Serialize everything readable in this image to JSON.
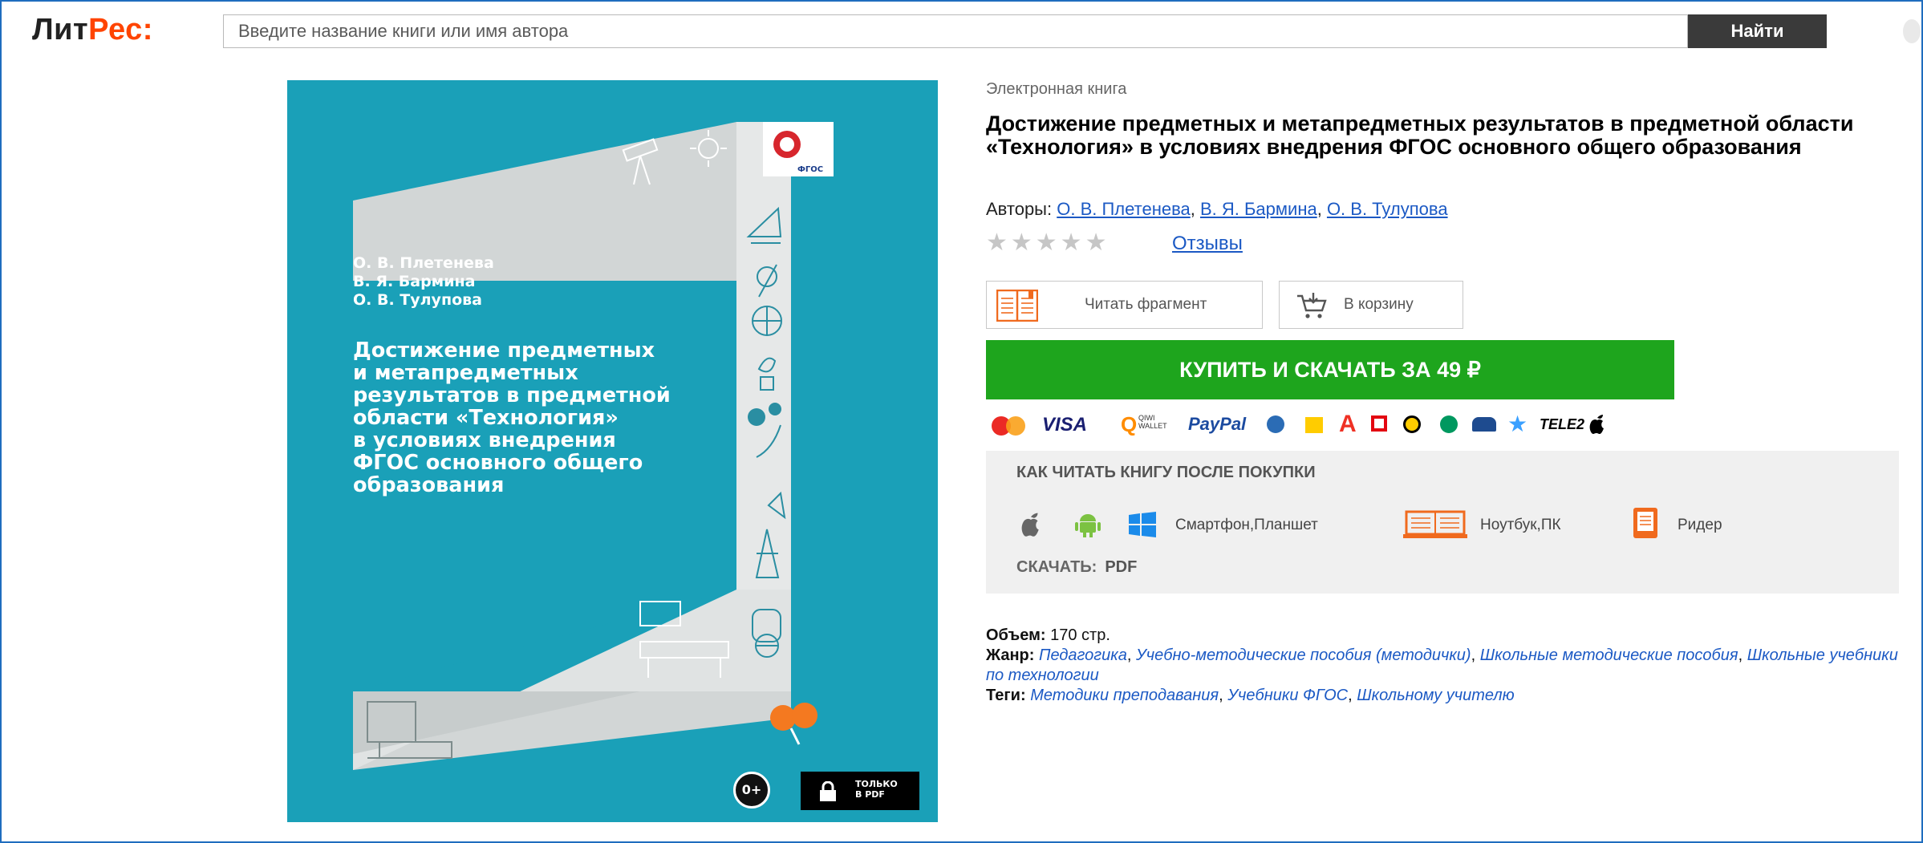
{
  "header": {
    "logo_part1": "Лит",
    "logo_part2": "Рес:",
    "search_placeholder": "Введите название книги или имя автора",
    "search_button": "Найти"
  },
  "cover": {
    "authors": [
      "О. В. Плетенева",
      "В. Я. Бармина",
      "О. В. Тулупова"
    ],
    "title_lines": [
      "Достижение предметных",
      "и метапредметных",
      "результатов в предметной",
      "области «Технология»",
      "в условиях внедрения",
      "ФГОС основного общего",
      "образования"
    ],
    "fgos_label": "ФГОС",
    "age_rating": "0+",
    "pdf_badge_line1": "ТОЛЬКО",
    "pdf_badge_line2": "В PDF",
    "background_color": "#1aa0b8"
  },
  "book": {
    "type_label": "Электронная книга",
    "title": "Достижение предметных и метапредметных результатов в предметной области «Технология» в условиях внедрения ФГОС основного общего образования",
    "authors_label": "Авторы:",
    "authors": [
      "О. В. Плетенева",
      "В. Я. Бармина",
      "О. В. Тулупова"
    ],
    "rating_stars": 0,
    "rating_max": 5,
    "reviews_link": "Отзывы"
  },
  "actions": {
    "read_fragment": "Читать фрагмент",
    "add_to_cart": "В корзину",
    "buy_button": "КУПИТЬ И СКАЧАТЬ ЗА 49 ₽",
    "buy_color": "#1ea51d"
  },
  "payment_methods": [
    "mastercard-icon",
    "VISA",
    "QIWI WALLET",
    "PayPal",
    "webmoney-icon",
    "yandex-money-icon",
    "alfa-bank-icon",
    "mts-icon",
    "beeline-icon",
    "megafon-icon",
    "sberbank-icon",
    "star-icon",
    "TELE2",
    "apple-pay-icon"
  ],
  "payment_texts": {
    "visa": "VISA",
    "qiwi": "QIWI",
    "qiwi_wallet": "WALLET",
    "paypal": "PayPal",
    "tele2": "TELE2"
  },
  "how_to_read": {
    "title": "КАК ЧИТАТЬ КНИГУ ПОСЛЕ ПОКУПКИ",
    "mobile_label": "Смартфон,Планшет",
    "laptop_label": "Ноутбук,ПК",
    "reader_label": "Ридер",
    "download_label": "СКАЧАТЬ:",
    "download_format": "PDF"
  },
  "details": {
    "volume_label": "Объем:",
    "volume_value": "170 стр.",
    "genre_label": "Жанр:",
    "genres": [
      "Педагогика",
      "Учебно-методические пособия (методички)",
      "Школьные методические пособия",
      "Школьные учебники по технологии"
    ],
    "tags_label": "Теги:",
    "tags": [
      "Методики преподавания",
      "Учебники ФГОС",
      "Школьному учителю"
    ]
  }
}
